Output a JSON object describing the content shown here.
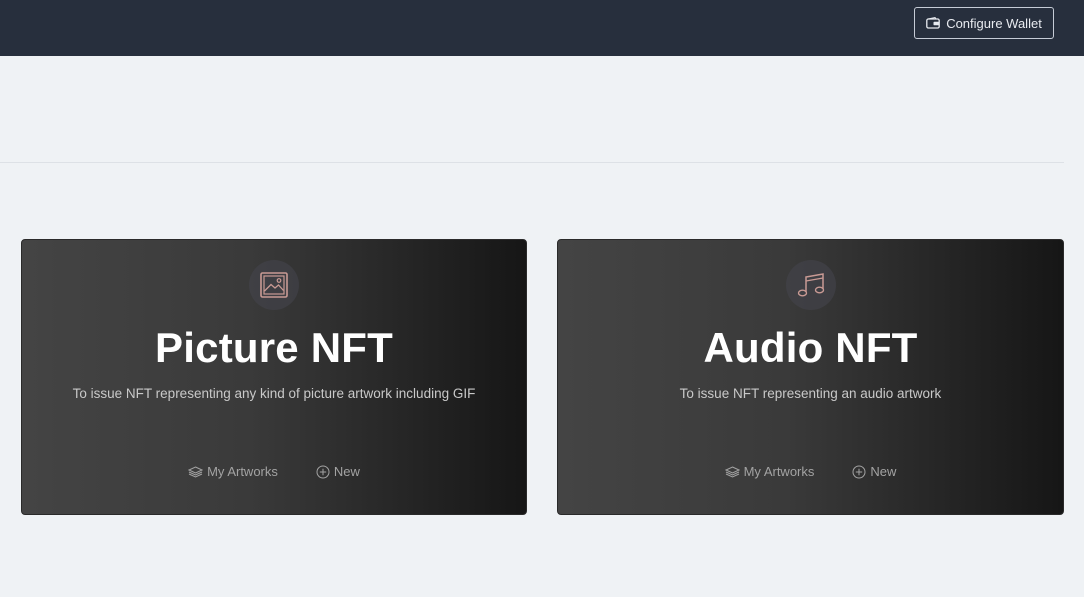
{
  "header": {
    "wallet_button_label": "Configure Wallet",
    "wallet_icon": "wallet-icon"
  },
  "cards": [
    {
      "icon": "picture-icon",
      "title": "Picture NFT",
      "description": "To issue NFT representing any kind of picture artwork including GIF",
      "actions": {
        "my_artworks": "My Artworks",
        "new": "New"
      }
    },
    {
      "icon": "music-note-icon",
      "title": "Audio NFT",
      "description": "To issue NFT representing an audio artwork",
      "actions": {
        "my_artworks": "My Artworks",
        "new": "New"
      }
    }
  ],
  "colors": {
    "header_bg": "#272f3d",
    "page_bg": "#eff2f5",
    "icon_accent": "#c99a94"
  }
}
